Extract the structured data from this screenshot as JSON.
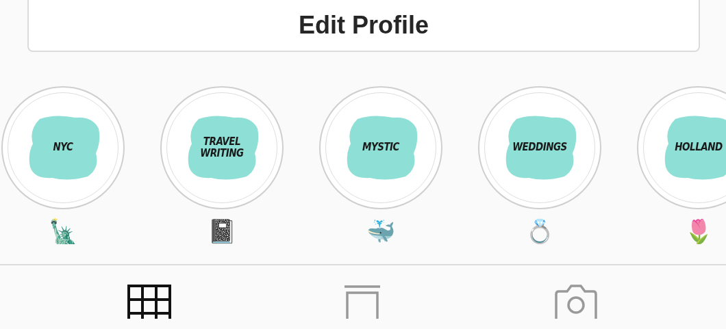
{
  "edit_profile": {
    "label": "Edit Profile"
  },
  "highlights": [
    {
      "title": "NYC",
      "emoji": "🗽"
    },
    {
      "title": "TRAVEL WRITING",
      "emoji": "📓"
    },
    {
      "title": "MYSTIC",
      "emoji": "🐳"
    },
    {
      "title": "WEDDINGS",
      "emoji": "💍"
    },
    {
      "title": "HOLLAND",
      "emoji": "🌷"
    }
  ],
  "tabs": [
    {
      "kind": "grid",
      "selected": true
    },
    {
      "kind": "feed",
      "selected": false
    },
    {
      "kind": "camera",
      "selected": false
    }
  ]
}
